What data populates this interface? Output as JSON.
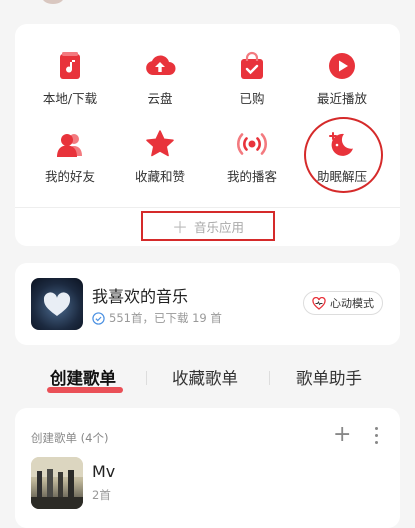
{
  "apps": [
    {
      "label": "本地/下载",
      "icon": "music-file-icon"
    },
    {
      "label": "云盘",
      "icon": "cloud-upload-icon"
    },
    {
      "label": "已购",
      "icon": "shopping-bag-icon"
    },
    {
      "label": "最近播放",
      "icon": "play-circle-icon"
    },
    {
      "label": "我的好友",
      "icon": "friends-icon"
    },
    {
      "label": "收藏和赞",
      "icon": "star-icon"
    },
    {
      "label": "我的播客",
      "icon": "broadcast-icon"
    },
    {
      "label": "助眠解压",
      "icon": "moon-icon"
    }
  ],
  "music_apps_label": "音乐应用",
  "liked": {
    "title": "我喜欢的音乐",
    "subtitle": "551首，已下载 19 首",
    "mode_button": "心动模式"
  },
  "tabs": [
    "创建歌单",
    "收藏歌单",
    "歌单助手"
  ],
  "playlists": {
    "header": "创建歌单 (4个)",
    "items": [
      {
        "title": "Mv",
        "count": "2首"
      }
    ]
  },
  "colors": {
    "accent": "#e8333b",
    "highlight": "#d52a2a"
  }
}
